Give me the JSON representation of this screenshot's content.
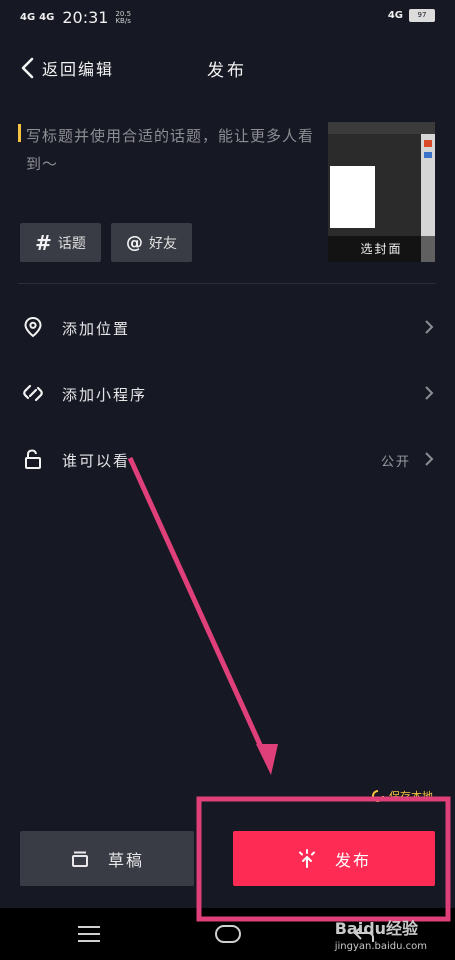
{
  "status_bar": {
    "network_1": "4G",
    "network_2": "4G",
    "time": "20:31",
    "speed_value": "20.5",
    "speed_unit": "KB/s",
    "network_right": "4G",
    "battery": "97"
  },
  "header": {
    "back_label": "返回编辑",
    "title": "发布"
  },
  "caption": {
    "placeholder": "写标题并使用合适的话题，能让更多人看到～"
  },
  "cover": {
    "label": "选封面"
  },
  "tags": {
    "topic_symbol": "#",
    "topic_label": "话题",
    "friend_symbol": "@",
    "friend_label": "好友"
  },
  "options": [
    {
      "label": "添加位置",
      "icon": "location-pin-icon"
    },
    {
      "label": "添加小程序",
      "icon": "mini-program-icon"
    },
    {
      "label": "谁可以看",
      "value": "公开",
      "icon": "unlock-icon"
    }
  ],
  "save_hint": "保存本地",
  "buttons": {
    "draft": "草稿",
    "publish": "发布"
  },
  "nav": [
    "menu-icon",
    "home-icon",
    "back-icon"
  ],
  "watermark": {
    "brand": "Baidu经验",
    "url": "jingyan.baidu.com"
  },
  "colors": {
    "background": "#161823",
    "publish": "#fe2c55",
    "annotation": "#e0407a",
    "cursor": "#f5c242"
  }
}
